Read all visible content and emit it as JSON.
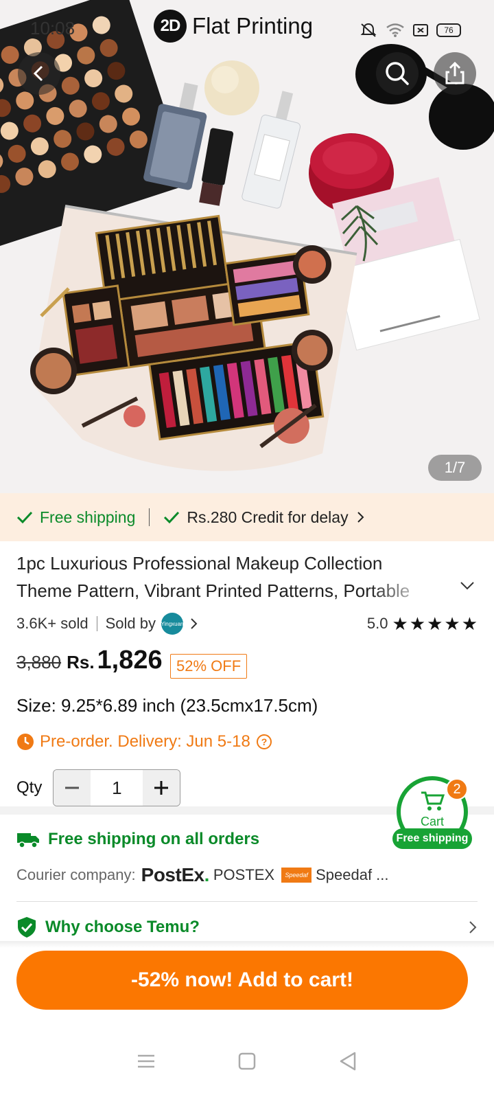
{
  "status_bar": {
    "time": "10:08",
    "battery": "76",
    "icons": [
      "bell-muted-icon",
      "wifi-icon",
      "sim-icon",
      "battery-icon"
    ]
  },
  "header": {
    "brand_badge": "2D",
    "brand_text": "Flat Printing"
  },
  "gallery": {
    "indicator": "1/7"
  },
  "shipping_banner": {
    "free_shipping": "Free shipping",
    "credit": "Rs.280 Credit for delay"
  },
  "product": {
    "title": "1pc Luxurious Professional Makeup Collection Theme Pattern, Vibrant Printed Patterns, Portable",
    "sold": "3.6K+ sold",
    "sold_by": "Sold by",
    "seller_avatar": "Yingxuan",
    "rating": "5.0",
    "stars": 5,
    "old_price": "3,880",
    "currency": "Rs.",
    "price": "1,826",
    "discount": "52% OFF",
    "size": "Size: 9.25*6.89 inch (23.5cmx17.5cm)",
    "preorder": "Pre-order. Delivery: Jun 5-18",
    "qty_label": "Qty",
    "qty_value": "1"
  },
  "cart": {
    "label": "Cart",
    "count": "2",
    "shipping": "Free shipping"
  },
  "shipping_info": {
    "free_all": "Free shipping on all orders",
    "courier_label": "Courier company:",
    "postex_logo": "PostEx",
    "postex_dot": ".",
    "postex_name": "POSTEX",
    "speedaf_logo": "Speedaf",
    "speedaf_name": "Speedaf ..."
  },
  "why_choose": {
    "label": "Why choose Temu?"
  },
  "cta": {
    "label": "-52% now! Add to cart!"
  },
  "colors": {
    "accent_orange": "#fb7701",
    "green": "#0a8a29",
    "banner_bg": "#fdeee0"
  }
}
